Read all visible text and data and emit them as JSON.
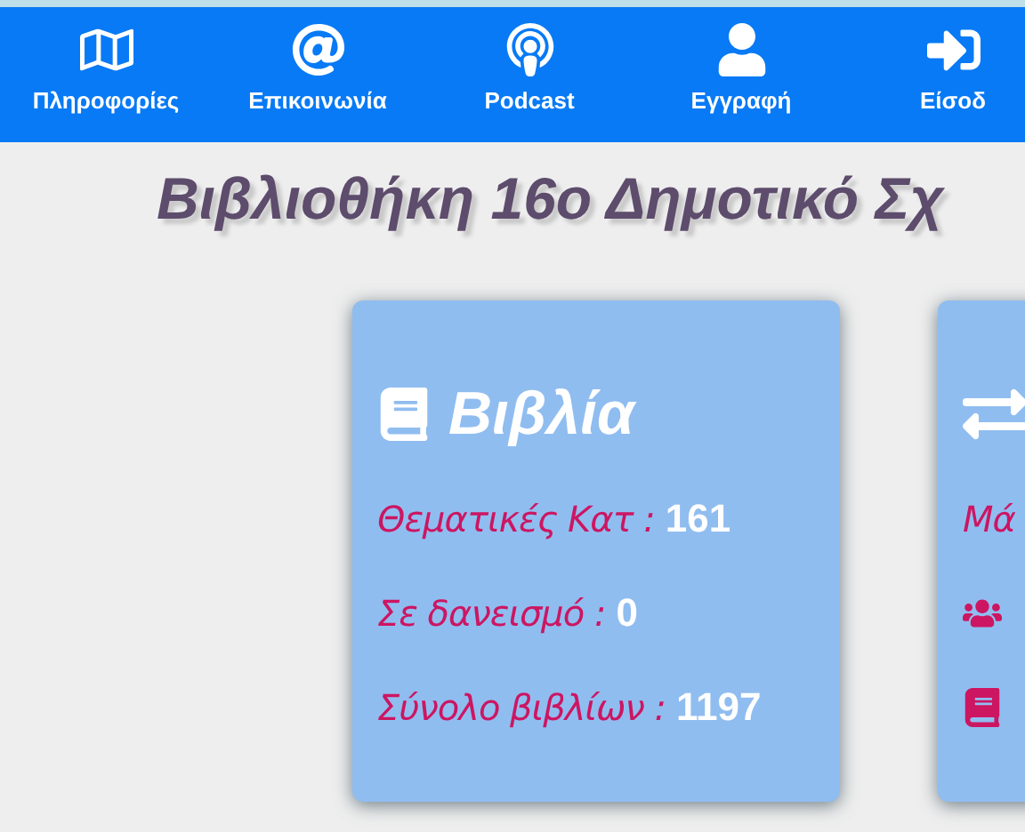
{
  "nav": {
    "items": [
      {
        "kind": "map",
        "label": "Πληροφορίες"
      },
      {
        "kind": "at",
        "label": "Επικοινωνία"
      },
      {
        "kind": "podcast",
        "label": "Podcast"
      },
      {
        "kind": "user",
        "label": "Εγγραφή"
      },
      {
        "kind": "signin",
        "label": "Είσοδ"
      }
    ]
  },
  "heading": "Βιβλιοθήκη 16ο Δημοτικό Σχ",
  "cards": [
    {
      "kind": "books",
      "title": "Βιβλία",
      "rows": [
        {
          "kind": "stat",
          "label": "Θεματικές Κατ :",
          "value": "161"
        },
        {
          "kind": "stat",
          "label": "Σε δανεισμό :",
          "value": "0"
        },
        {
          "kind": "stat",
          "label": "Σύνολο βιβλίων :",
          "value": "1197"
        }
      ]
    },
    {
      "kind": "loans",
      "rows": [
        {
          "kind": "stat",
          "label": "Μά"
        },
        {
          "kind": "users"
        },
        {
          "kind": "book"
        }
      ]
    }
  ]
}
